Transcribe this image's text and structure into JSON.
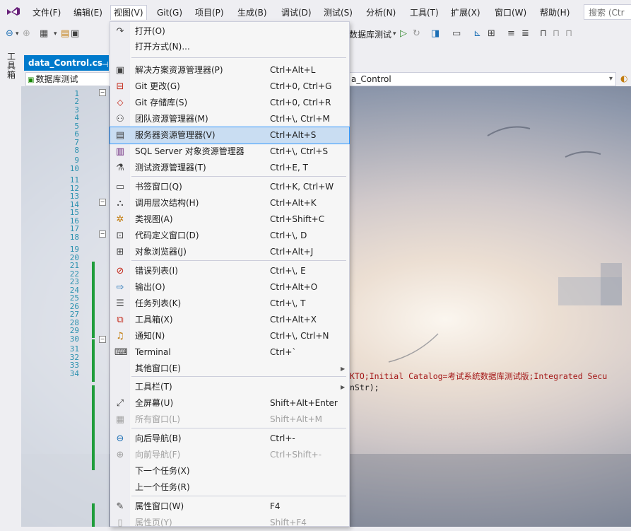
{
  "menubar": {
    "items": [
      "文件(F)",
      "编辑(E)",
      "视图(V)",
      "Git(G)",
      "项目(P)",
      "生成(B)",
      "调试(D)",
      "测试(S)",
      "分析(N)",
      "工具(T)",
      "扩展(X)",
      "窗口(W)",
      "帮助(H)"
    ],
    "search_placeholder": "搜索 (Ctr"
  },
  "toolbar": {
    "config_label": "数据库测试"
  },
  "side_toolbox": {
    "label": "工具箱"
  },
  "document": {
    "tab_title": "data_Control.cs",
    "scope_combo": "数据库测试",
    "member_combo": "a_Control"
  },
  "editor": {
    "line_numbers": [
      "1",
      "2",
      "3",
      "4",
      "5",
      "6",
      "7",
      "8",
      "9",
      "10",
      "11",
      "12",
      "13",
      "14",
      "15",
      "16",
      "17",
      "18",
      "19",
      "20",
      "21",
      "22",
      "23",
      "24",
      "25",
      "26",
      "27",
      "28",
      "29",
      "30",
      "31",
      "32",
      "33",
      "34"
    ],
    "code_line_22": "KTO;Initial Catalog=考试系统数据库测试版;Integrated Secu",
    "code_line_23": "nStr);"
  },
  "view_menu": {
    "items": [
      {
        "icon": "redo-arrow-icon",
        "label": "打开(O)",
        "shortcut": ""
      },
      {
        "icon": "",
        "label": "打开方式(N)...",
        "shortcut": ""
      },
      {
        "icon": "solution-explorer-icon",
        "label": "解决方案资源管理器(P)",
        "shortcut": "Ctrl+Alt+L"
      },
      {
        "icon": "git-changes-icon",
        "label": "Git 更改(G)",
        "shortcut": "Ctrl+0, Ctrl+G"
      },
      {
        "icon": "git-repository-icon",
        "label": "Git 存储库(S)",
        "shortcut": "Ctrl+0, Ctrl+R"
      },
      {
        "icon": "team-explorer-icon",
        "label": "团队资源管理器(M)",
        "shortcut": "Ctrl+\\, Ctrl+M"
      },
      {
        "icon": "server-explorer-icon",
        "label": "服务器资源管理器(V)",
        "shortcut": "Ctrl+Alt+S"
      },
      {
        "icon": "sql-server-icon",
        "label": "SQL Server 对象资源管理器",
        "shortcut": "Ctrl+\\, Ctrl+S"
      },
      {
        "icon": "test-explorer-icon",
        "label": "测试资源管理器(T)",
        "shortcut": "Ctrl+E, T"
      },
      {
        "icon": "bookmark-window-icon",
        "label": "书签窗口(Q)",
        "shortcut": "Ctrl+K, Ctrl+W"
      },
      {
        "icon": "call-hierarchy-icon",
        "label": "调用层次结构(H)",
        "shortcut": "Ctrl+Alt+K"
      },
      {
        "icon": "class-view-icon",
        "label": "类视图(A)",
        "shortcut": "Ctrl+Shift+C"
      },
      {
        "icon": "code-definition-icon",
        "label": "代码定义窗口(D)",
        "shortcut": "Ctrl+\\, D"
      },
      {
        "icon": "object-browser-icon",
        "label": "对象浏览器(J)",
        "shortcut": "Ctrl+Alt+J"
      },
      {
        "icon": "error-list-icon",
        "label": "错误列表(I)",
        "shortcut": "Ctrl+\\, E"
      },
      {
        "icon": "output-icon",
        "label": "输出(O)",
        "shortcut": "Ctrl+Alt+O"
      },
      {
        "icon": "task-list-icon",
        "label": "任务列表(K)",
        "shortcut": "Ctrl+\\, T"
      },
      {
        "icon": "toolbox-icon",
        "label": "工具箱(X)",
        "shortcut": "Ctrl+Alt+X"
      },
      {
        "icon": "notification-bell-icon",
        "label": "通知(N)",
        "shortcut": "Ctrl+\\, Ctrl+N"
      },
      {
        "icon": "terminal-icon",
        "label": "Terminal",
        "shortcut": "Ctrl+`"
      },
      {
        "icon": "",
        "label": "其他窗口(E)",
        "shortcut": ""
      },
      {
        "icon": "",
        "label": "工具栏(T)",
        "shortcut": ""
      },
      {
        "icon": "full-screen-icon",
        "label": "全屏幕(U)",
        "shortcut": "Shift+Alt+Enter"
      },
      {
        "icon": "all-windows-icon",
        "label": "所有窗口(L)",
        "shortcut": "Shift+Alt+M"
      },
      {
        "icon": "navigate-backward-icon",
        "label": "向后导航(B)",
        "shortcut": "Ctrl+-"
      },
      {
        "icon": "navigate-forward-icon",
        "label": "向前导航(F)",
        "shortcut": "Ctrl+Shift+-"
      },
      {
        "icon": "",
        "label": "下一个任务(X)",
        "shortcut": ""
      },
      {
        "icon": "",
        "label": "上一个任务(R)",
        "shortcut": ""
      },
      {
        "icon": "properties-wrench-icon",
        "label": "属性窗口(W)",
        "shortcut": "F4"
      },
      {
        "icon": "property-pages-icon",
        "label": "属性页(Y)",
        "shortcut": "Shift+F4"
      }
    ],
    "highlighted_item": "服务器资源管理器(V)"
  },
  "colors": {
    "accent": "#007acc",
    "menu_highlight": "#c9ddf2",
    "change_bar": "#1f9d3b",
    "string_literal": "#a31515",
    "line_number": "#2b91af"
  }
}
